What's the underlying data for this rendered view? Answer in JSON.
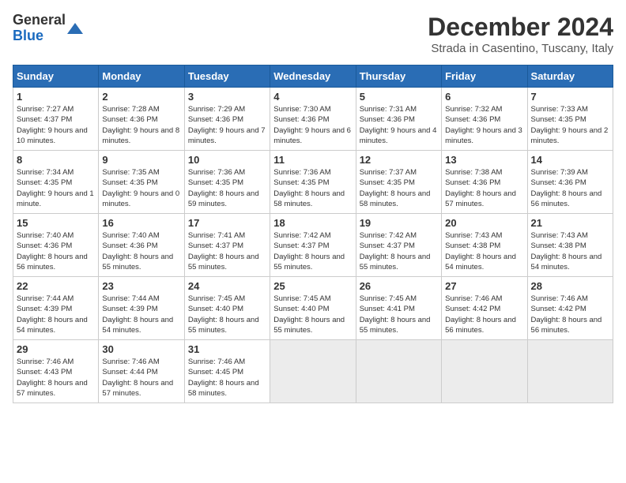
{
  "header": {
    "logo_general": "General",
    "logo_blue": "Blue",
    "title": "December 2024",
    "location": "Strada in Casentino, Tuscany, Italy"
  },
  "days_of_week": [
    "Sunday",
    "Monday",
    "Tuesday",
    "Wednesday",
    "Thursday",
    "Friday",
    "Saturday"
  ],
  "weeks": [
    [
      {
        "day": 1,
        "sunrise": "7:27 AM",
        "sunset": "4:37 PM",
        "daylight": "9 hours and 10 minutes."
      },
      {
        "day": 2,
        "sunrise": "7:28 AM",
        "sunset": "4:36 PM",
        "daylight": "9 hours and 8 minutes."
      },
      {
        "day": 3,
        "sunrise": "7:29 AM",
        "sunset": "4:36 PM",
        "daylight": "9 hours and 7 minutes."
      },
      {
        "day": 4,
        "sunrise": "7:30 AM",
        "sunset": "4:36 PM",
        "daylight": "9 hours and 6 minutes."
      },
      {
        "day": 5,
        "sunrise": "7:31 AM",
        "sunset": "4:36 PM",
        "daylight": "9 hours and 4 minutes."
      },
      {
        "day": 6,
        "sunrise": "7:32 AM",
        "sunset": "4:36 PM",
        "daylight": "9 hours and 3 minutes."
      },
      {
        "day": 7,
        "sunrise": "7:33 AM",
        "sunset": "4:35 PM",
        "daylight": "9 hours and 2 minutes."
      }
    ],
    [
      {
        "day": 8,
        "sunrise": "7:34 AM",
        "sunset": "4:35 PM",
        "daylight": "9 hours and 1 minute."
      },
      {
        "day": 9,
        "sunrise": "7:35 AM",
        "sunset": "4:35 PM",
        "daylight": "9 hours and 0 minutes."
      },
      {
        "day": 10,
        "sunrise": "7:36 AM",
        "sunset": "4:35 PM",
        "daylight": "8 hours and 59 minutes."
      },
      {
        "day": 11,
        "sunrise": "7:36 AM",
        "sunset": "4:35 PM",
        "daylight": "8 hours and 58 minutes."
      },
      {
        "day": 12,
        "sunrise": "7:37 AM",
        "sunset": "4:35 PM",
        "daylight": "8 hours and 58 minutes."
      },
      {
        "day": 13,
        "sunrise": "7:38 AM",
        "sunset": "4:36 PM",
        "daylight": "8 hours and 57 minutes."
      },
      {
        "day": 14,
        "sunrise": "7:39 AM",
        "sunset": "4:36 PM",
        "daylight": "8 hours and 56 minutes."
      }
    ],
    [
      {
        "day": 15,
        "sunrise": "7:40 AM",
        "sunset": "4:36 PM",
        "daylight": "8 hours and 56 minutes."
      },
      {
        "day": 16,
        "sunrise": "7:40 AM",
        "sunset": "4:36 PM",
        "daylight": "8 hours and 55 minutes."
      },
      {
        "day": 17,
        "sunrise": "7:41 AM",
        "sunset": "4:37 PM",
        "daylight": "8 hours and 55 minutes."
      },
      {
        "day": 18,
        "sunrise": "7:42 AM",
        "sunset": "4:37 PM",
        "daylight": "8 hours and 55 minutes."
      },
      {
        "day": 19,
        "sunrise": "7:42 AM",
        "sunset": "4:37 PM",
        "daylight": "8 hours and 55 minutes."
      },
      {
        "day": 20,
        "sunrise": "7:43 AM",
        "sunset": "4:38 PM",
        "daylight": "8 hours and 54 minutes."
      },
      {
        "day": 21,
        "sunrise": "7:43 AM",
        "sunset": "4:38 PM",
        "daylight": "8 hours and 54 minutes."
      }
    ],
    [
      {
        "day": 22,
        "sunrise": "7:44 AM",
        "sunset": "4:39 PM",
        "daylight": "8 hours and 54 minutes."
      },
      {
        "day": 23,
        "sunrise": "7:44 AM",
        "sunset": "4:39 PM",
        "daylight": "8 hours and 54 minutes."
      },
      {
        "day": 24,
        "sunrise": "7:45 AM",
        "sunset": "4:40 PM",
        "daylight": "8 hours and 55 minutes."
      },
      {
        "day": 25,
        "sunrise": "7:45 AM",
        "sunset": "4:40 PM",
        "daylight": "8 hours and 55 minutes."
      },
      {
        "day": 26,
        "sunrise": "7:45 AM",
        "sunset": "4:41 PM",
        "daylight": "8 hours and 55 minutes."
      },
      {
        "day": 27,
        "sunrise": "7:46 AM",
        "sunset": "4:42 PM",
        "daylight": "8 hours and 56 minutes."
      },
      {
        "day": 28,
        "sunrise": "7:46 AM",
        "sunset": "4:42 PM",
        "daylight": "8 hours and 56 minutes."
      }
    ],
    [
      {
        "day": 29,
        "sunrise": "7:46 AM",
        "sunset": "4:43 PM",
        "daylight": "8 hours and 57 minutes."
      },
      {
        "day": 30,
        "sunrise": "7:46 AM",
        "sunset": "4:44 PM",
        "daylight": "8 hours and 57 minutes."
      },
      {
        "day": 31,
        "sunrise": "7:46 AM",
        "sunset": "4:45 PM",
        "daylight": "8 hours and 58 minutes."
      },
      null,
      null,
      null,
      null
    ]
  ]
}
